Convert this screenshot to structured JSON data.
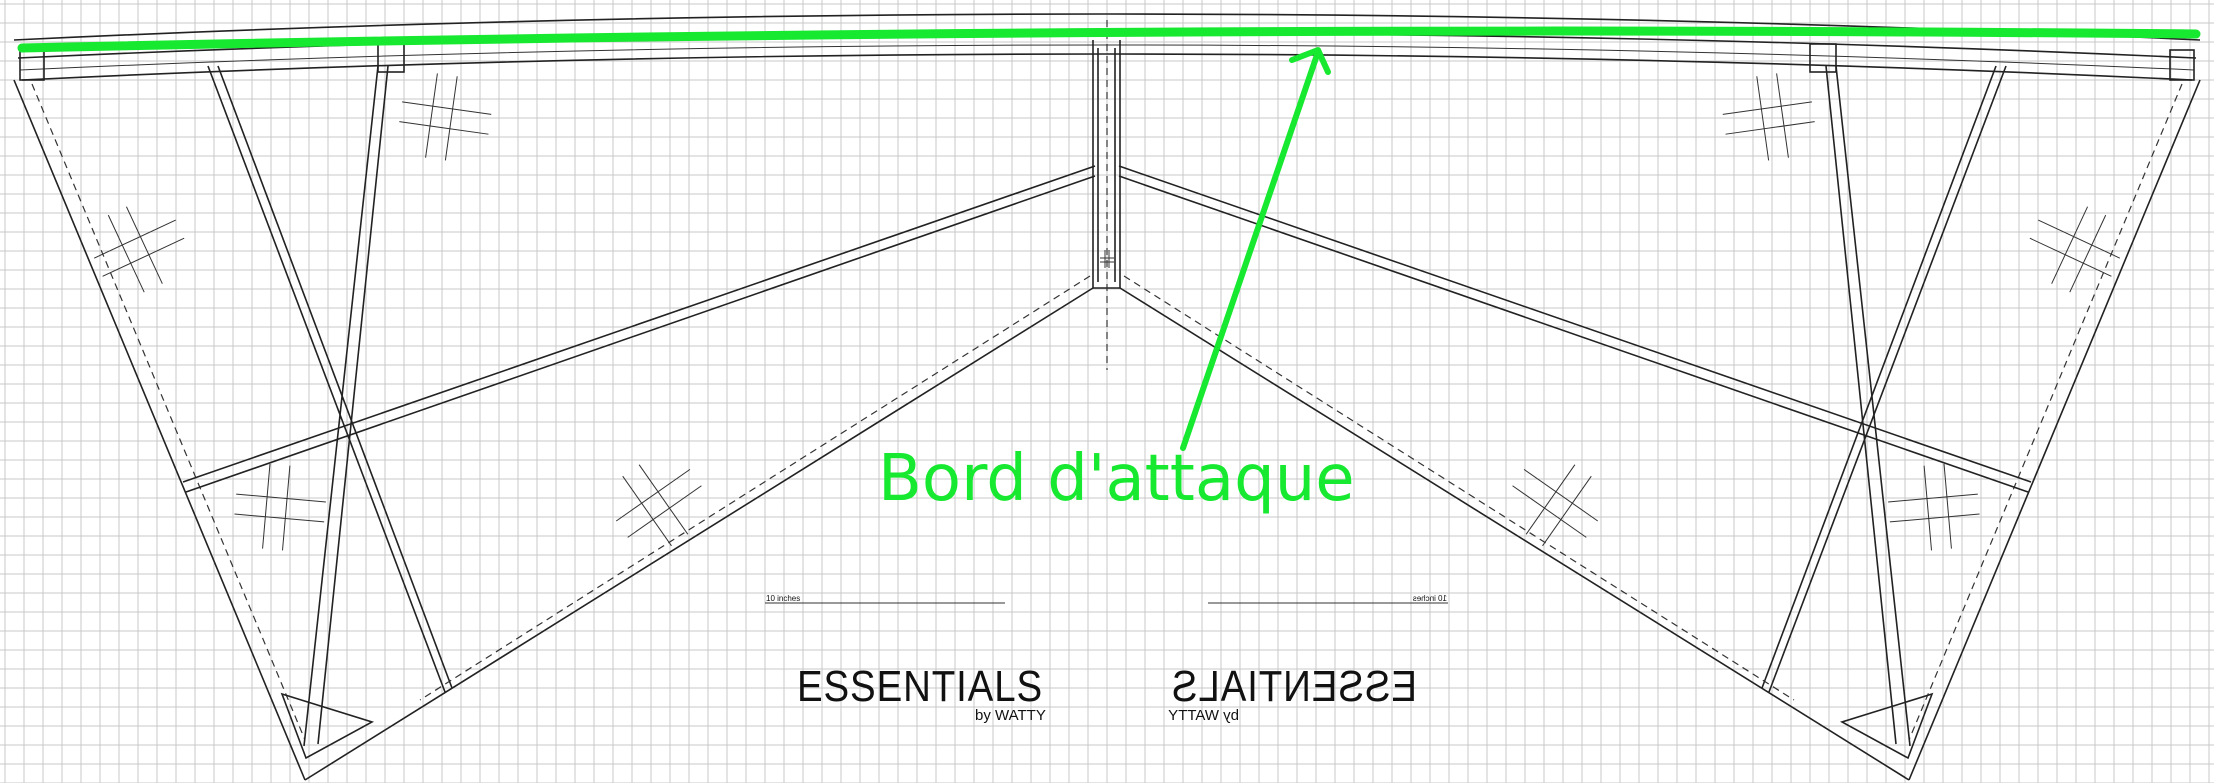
{
  "annotation": {
    "label": "Bord d'attaque",
    "color": "#17e830"
  },
  "branding": {
    "logo_text": "ESSENTIALS",
    "logo_sub": "by WATTY",
    "mirrored": true
  },
  "scale_bar": {
    "label": "10 inches"
  },
  "colors": {
    "grid": "#c8c8c8",
    "ink": "#222222",
    "highlight": "#17e830"
  }
}
